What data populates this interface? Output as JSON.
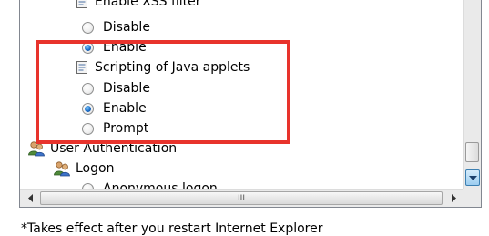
{
  "tree": {
    "xss_filter_label": "Enable XSS filter",
    "xss_disable": "Disable",
    "xss_enable": "Enable",
    "java_label": "Scripting of Java applets",
    "java_disable": "Disable",
    "java_enable": "Enable",
    "java_prompt": "Prompt",
    "user_auth_label": "User Authentication",
    "logon_label": "Logon",
    "anonymous_logon": "Anonymous logon"
  },
  "selection": {
    "xss": "Enable",
    "java": "Enable"
  },
  "hscroll_grip": "III",
  "footnote": "*Takes effect after you restart Internet Explorer",
  "colors": {
    "highlight_border": "#e8332c",
    "radio_checked": "#1d6fc8",
    "scroll_down_button": "#9ccdf0"
  },
  "icons": [
    "settings-page-icon",
    "users-icon",
    "scroll-left-icon",
    "scroll-right-icon",
    "scroll-down-icon"
  ]
}
